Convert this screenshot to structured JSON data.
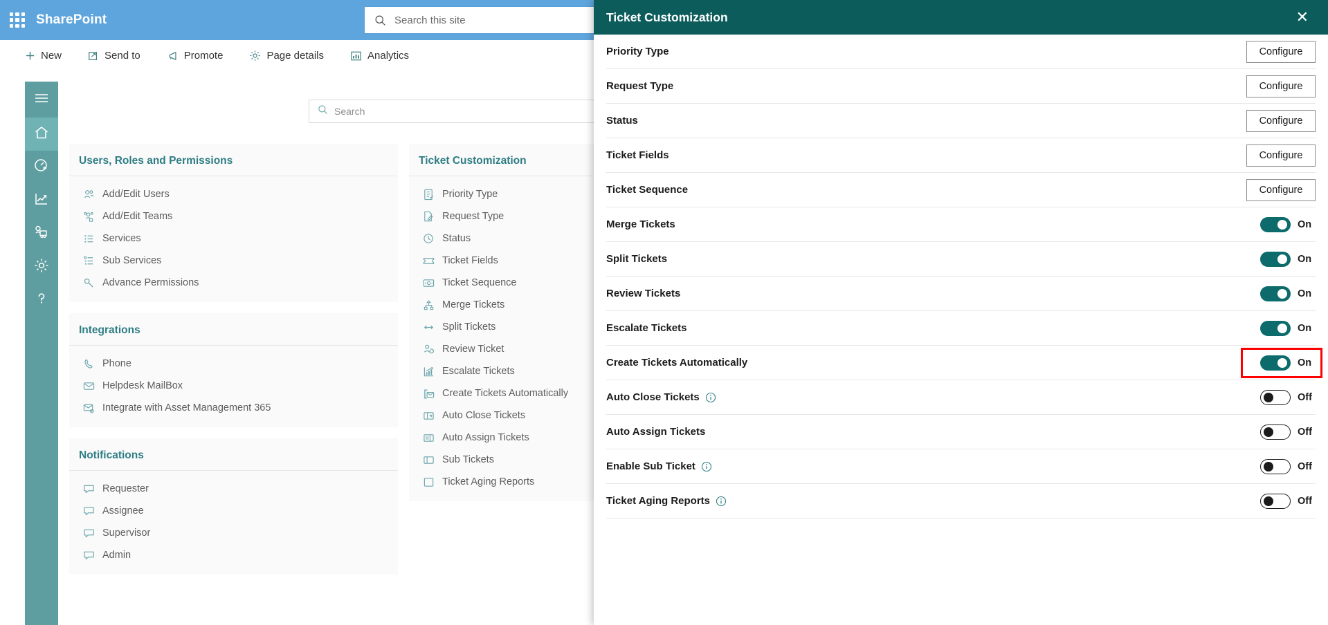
{
  "suitebar": {
    "waffle_icon": "app-launcher-icon",
    "brand": "SharePoint",
    "search": {
      "icon": "search-icon",
      "placeholder": "Search this site",
      "value": ""
    }
  },
  "commandbar": {
    "items": [
      {
        "label": "New",
        "icon": "plus-icon"
      },
      {
        "label": "Send to",
        "icon": "send-to-icon"
      },
      {
        "label": "Promote",
        "icon": "promote-megaphone-icon"
      },
      {
        "label": "Page details",
        "icon": "gear-icon"
      },
      {
        "label": "Analytics",
        "icon": "analytics-bar-icon"
      }
    ]
  },
  "rail": {
    "items": [
      {
        "name": "menu-hamburger",
        "icon": "hamburger-icon",
        "active": false
      },
      {
        "name": "home",
        "icon": "home-icon",
        "active": true
      },
      {
        "name": "dashboard",
        "icon": "gauge-icon",
        "active": false
      },
      {
        "name": "reports",
        "icon": "line-chart-icon",
        "active": false
      },
      {
        "name": "teams",
        "icon": "people-presentation-icon",
        "active": false
      },
      {
        "name": "settings",
        "icon": "gear-icon",
        "active": false
      },
      {
        "name": "help",
        "icon": "question-mark-icon",
        "active": false
      }
    ]
  },
  "page_search": {
    "icon": "search-icon",
    "placeholder": "Search",
    "value": ""
  },
  "columns": [
    {
      "cards": [
        {
          "title": "Users, Roles and Permissions",
          "items": [
            {
              "label": "Add/Edit Users",
              "icon": "users-icon"
            },
            {
              "label": "Add/Edit Teams",
              "icon": "team-badge-icon"
            },
            {
              "label": "Services",
              "icon": "list-icon"
            },
            {
              "label": "Sub Services",
              "icon": "sub-list-icon"
            },
            {
              "label": "Advance Permissions",
              "icon": "key-icon"
            }
          ]
        },
        {
          "title": "Integrations",
          "items": [
            {
              "label": "Phone",
              "icon": "phone-icon"
            },
            {
              "label": "Helpdesk MailBox",
              "icon": "mail-icon"
            },
            {
              "label": "Integrate with Asset Management 365",
              "icon": "mail-gear-icon"
            }
          ]
        },
        {
          "title": "Notifications",
          "items": [
            {
              "label": "Requester",
              "icon": "comment-icon"
            },
            {
              "label": "Assignee",
              "icon": "comment-icon"
            },
            {
              "label": "Supervisor",
              "icon": "comment-icon"
            },
            {
              "label": "Admin",
              "icon": "comment-icon"
            }
          ]
        }
      ]
    },
    {
      "cards": [
        {
          "title": "Ticket Customization",
          "items": [
            {
              "label": "Priority Type",
              "icon": "priority-list-icon"
            },
            {
              "label": "Request Type",
              "icon": "edit-page-icon"
            },
            {
              "label": "Status",
              "icon": "clock-check-icon"
            },
            {
              "label": "Ticket Fields",
              "icon": "ticket-icon"
            },
            {
              "label": "Ticket Sequence",
              "icon": "sequence-icon"
            },
            {
              "label": "Merge Tickets",
              "icon": "merge-icon"
            },
            {
              "label": "Split Tickets",
              "icon": "split-arrows-icon"
            },
            {
              "label": "Review Ticket",
              "icon": "review-person-icon"
            },
            {
              "label": "Escalate Tickets",
              "icon": "escalate-chart-icon"
            },
            {
              "label": "Create Tickets Automatically",
              "icon": "auto-mail-icon"
            },
            {
              "label": "Auto Close Tickets",
              "icon": "auto-close-icon"
            },
            {
              "label": "Auto Assign Tickets",
              "icon": "auto-assign-icon"
            },
            {
              "label": "Sub Tickets",
              "icon": "sub-ticket-icon"
            },
            {
              "label": "Ticket Aging Reports",
              "icon": "aging-report-icon"
            }
          ]
        }
      ]
    }
  ],
  "panel": {
    "title": "Ticket Customization",
    "close_icon": "close-icon",
    "configure_label": "Configure",
    "rows": [
      {
        "label": "Priority Type",
        "control": "button"
      },
      {
        "label": "Request Type",
        "control": "button"
      },
      {
        "label": "Status",
        "control": "button"
      },
      {
        "label": "Ticket Fields",
        "control": "button"
      },
      {
        "label": "Ticket Sequence",
        "control": "button"
      },
      {
        "label": "Merge Tickets",
        "control": "toggle",
        "state": "On",
        "info": false,
        "highlighted": false
      },
      {
        "label": "Split Tickets",
        "control": "toggle",
        "state": "On",
        "info": false,
        "highlighted": false
      },
      {
        "label": "Review Tickets",
        "control": "toggle",
        "state": "On",
        "info": false,
        "highlighted": false
      },
      {
        "label": "Escalate Tickets",
        "control": "toggle",
        "state": "On",
        "info": false,
        "highlighted": false
      },
      {
        "label": "Create Tickets Automatically",
        "control": "toggle",
        "state": "On",
        "info": false,
        "highlighted": true
      },
      {
        "label": "Auto Close Tickets",
        "control": "toggle",
        "state": "Off",
        "info": true,
        "highlighted": false
      },
      {
        "label": "Auto Assign Tickets",
        "control": "toggle",
        "state": "Off",
        "info": false,
        "highlighted": false
      },
      {
        "label": "Enable Sub Ticket",
        "control": "toggle",
        "state": "Off",
        "info": true,
        "highlighted": false
      },
      {
        "label": "Ticket Aging Reports",
        "control": "toggle",
        "state": "Off",
        "info": true,
        "highlighted": false
      }
    ]
  },
  "colors": {
    "suitebar": "#5ea5dd",
    "rail": "#5f9ea0",
    "rail_active": "#6fb3b5",
    "panel_header": "#0d5c5c",
    "toggle_on": "#0d6b6b",
    "card_title": "#2e7d84",
    "highlight": "#ff0000"
  }
}
